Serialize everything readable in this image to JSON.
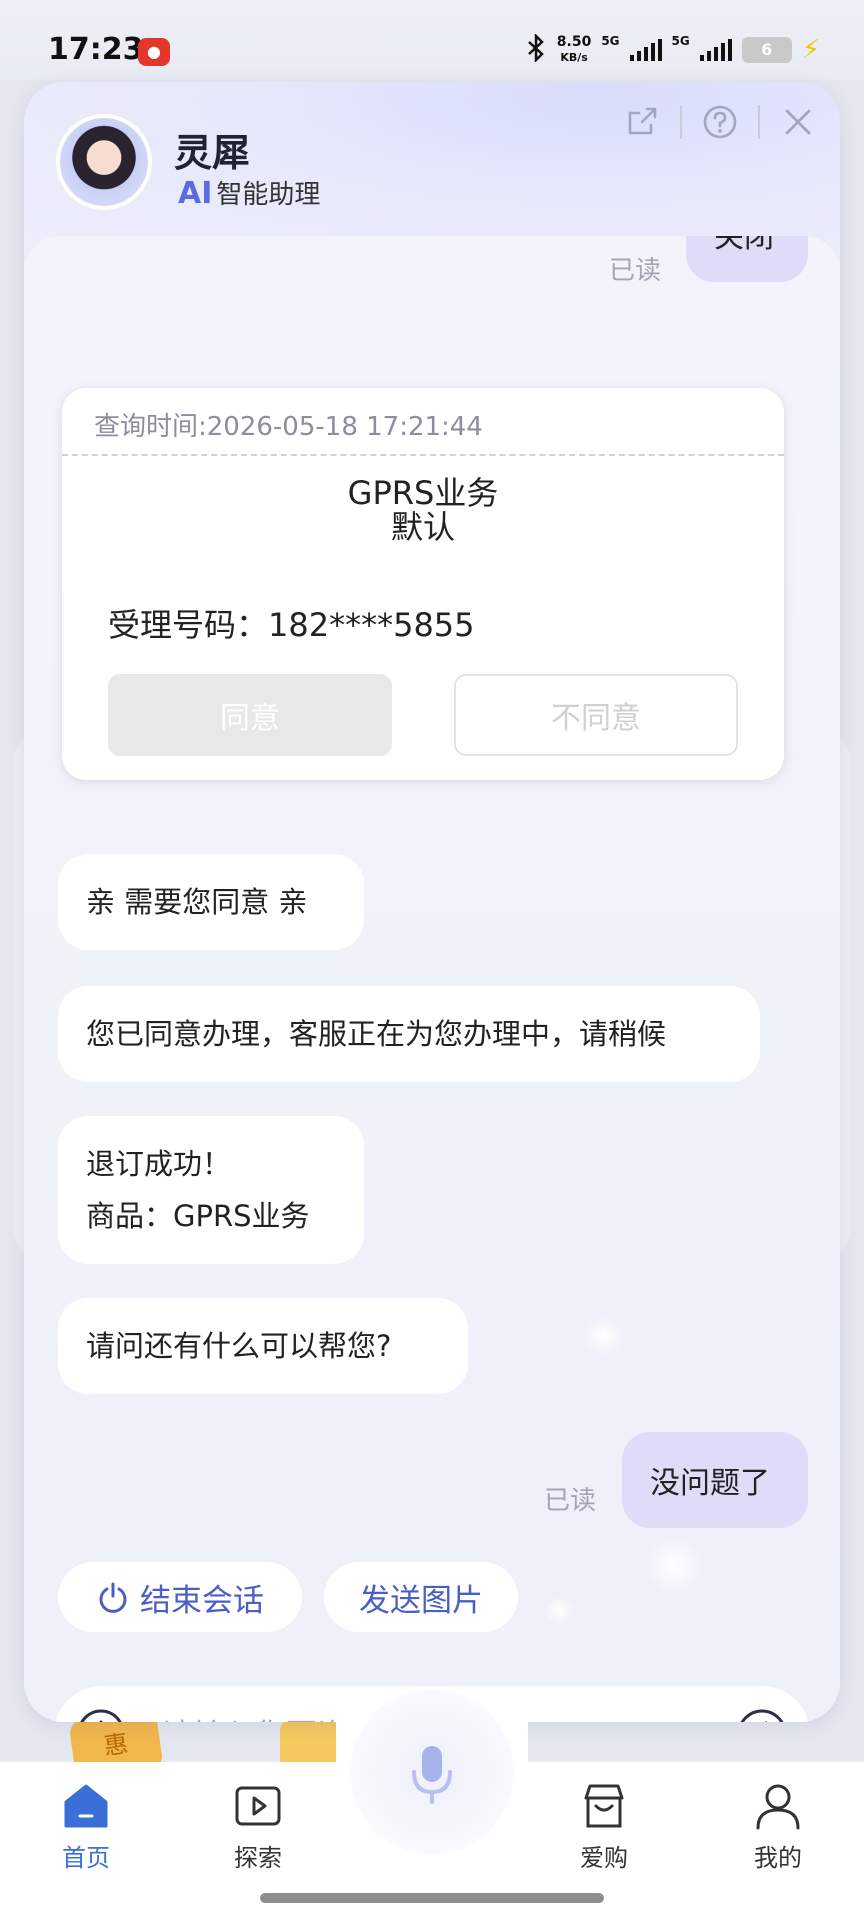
{
  "status_bar": {
    "time": "17:23",
    "net_speed_value": "8.50",
    "net_speed_unit": "KB/s",
    "signal1_label": "5G",
    "signal2_label": "5G",
    "battery": "6",
    "icons": [
      "notification-app-icon",
      "bluetooth-icon",
      "signal-icon",
      "battery-icon",
      "charging-icon"
    ]
  },
  "assistant": {
    "name": "灵犀",
    "ai_badge": "AI",
    "subtitle": "智能助理",
    "header_icons": [
      "share-icon",
      "help-icon",
      "close-icon"
    ]
  },
  "chat": {
    "top_user_bubble": "关闭",
    "top_read": "已读",
    "card": {
      "query_time": "查询时间:2026-05-18 17:21:44",
      "title": "GPRS业务",
      "subtitle": "默认",
      "phone": "受理号码：182****5855",
      "agree_label": "同意",
      "disagree_label": "不同意"
    },
    "bot_messages": [
      {
        "lines": [
          "亲 需要您同意 亲"
        ]
      },
      {
        "lines": [
          "您已同意办理，客服正在为您办理中，请稍候"
        ]
      },
      {
        "lines": [
          "退订成功！",
          "商品：GPRS业务"
        ]
      },
      {
        "lines": [
          "请问还有什么可以帮您?"
        ]
      }
    ],
    "user_message": "没问题了",
    "user_read": "已读"
  },
  "quick_actions": {
    "end_session": "结束会话",
    "send_image": "发送图片"
  },
  "input": {
    "placeholder": "请输入您要咨询的内容"
  },
  "bottom_nav": {
    "items": [
      {
        "label": "首页",
        "icon": "home-icon",
        "active": true
      },
      {
        "label": "探索",
        "icon": "play-icon",
        "active": false
      },
      {
        "label": "爱购",
        "icon": "shop-icon",
        "active": false
      },
      {
        "label": "我的",
        "icon": "user-icon",
        "active": false
      }
    ],
    "center_icon": "microphone-icon"
  },
  "colors": {
    "accent": "#4a5ec4",
    "nav_active": "#3a6fd8",
    "user_bubble": "#dfdcf8"
  }
}
